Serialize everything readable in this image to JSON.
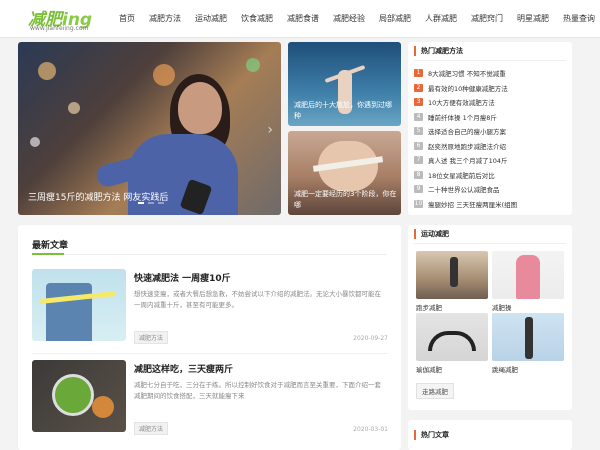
{
  "logo": {
    "main": "减肥",
    "suffix": "ing",
    "url": "www.jianfeiing.com"
  },
  "nav": [
    "首页",
    "减肥方法",
    "运动减肥",
    "饮食减肥",
    "减肥食谱",
    "减肥经验",
    "局部减肥",
    "人群减肥",
    "减肥窍门",
    "明星减肥",
    "热量查询"
  ],
  "hero": {
    "caption": "三周瘦15斤的减肥方法 网友实践后"
  },
  "side_thumbs": [
    {
      "caption": "减肥后的十大尴尬，你遇到过哪种"
    },
    {
      "caption": "减肥一定要经历的3个阶段，你在哪"
    }
  ],
  "latest": {
    "title": "最新文章",
    "articles": [
      {
        "title": "快速减肥法 一周瘦10斤",
        "desc": "想快速变瘦，或者大餐后想急救，不妨尝试以下介绍的减肥法。无论大小暴饮都可能在一周内减重十斤，甚至有可能更多。",
        "tag": "减肥方法",
        "date": "2020-09-27"
      },
      {
        "title": "减肥这样吃，三天瘦两斤",
        "desc": "减肥七分自于吃，三分在于练。所以控制好饮食对于减肥而言至关重要，下面介绍一套减肥期间的饮食搭配，三天就能瘦下来",
        "tag": "减肥方法",
        "date": "2020-03-01"
      }
    ]
  },
  "hot": {
    "title": "热门减肥方法",
    "items": [
      "8大减肥习惯 不知不觉减重",
      "最有效的10种健康减肥方法",
      "10大方便有效减肥方法",
      "睡前纤体操 1个月瘦8斤",
      "选择适合自己的瘦小腿方案",
      "赵奕然原地跑步减肥法介绍",
      "真人述 我三个月减了104斤",
      "18位女星减肥前后对比",
      "二十种世界公认减肥食品",
      "瘦腿妙招 三天狂瘦两厘米(组图"
    ]
  },
  "sport": {
    "title": "运动减肥",
    "items": [
      "跑步减肥",
      "减肥操",
      "瑜伽减肥",
      "跳绳减肥"
    ],
    "more": "走路减肥"
  },
  "hot_articles": {
    "title": "热门文章"
  },
  "colors": {
    "brand": "#7bbf3a",
    "accent": "#e8683a"
  }
}
